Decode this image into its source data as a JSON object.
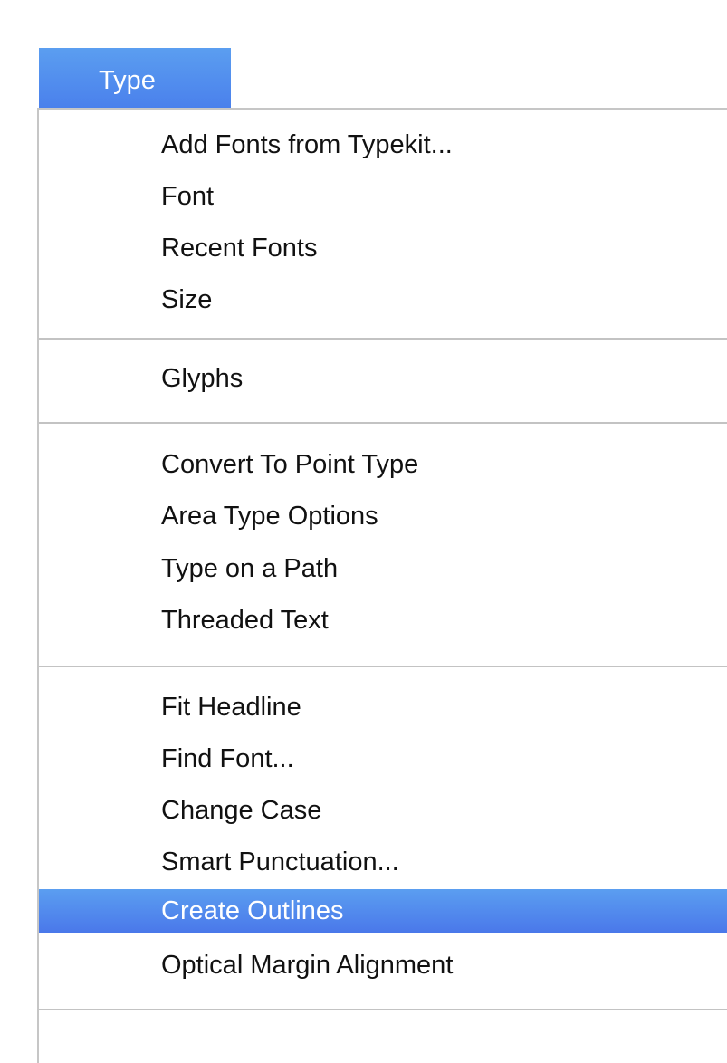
{
  "menu_bar": {
    "title": "Type"
  },
  "menu": {
    "groups": [
      {
        "items": [
          "Add Fonts from Typekit...",
          "Font",
          "Recent Fonts",
          "Size"
        ]
      },
      {
        "items": [
          "Glyphs"
        ]
      },
      {
        "items": [
          "Convert To Point Type",
          "Area Type Options",
          "Type on a Path",
          "Threaded Text"
        ]
      },
      {
        "items": [
          "Fit Headline",
          "Find Font...",
          "Change Case",
          "Smart Punctuation...",
          "Create Outlines",
          "Optical Margin Alignment"
        ]
      }
    ],
    "selected_item": "Create Outlines"
  },
  "colors": {
    "highlight": "#4a80ec",
    "separator": "#c3c3c3"
  }
}
